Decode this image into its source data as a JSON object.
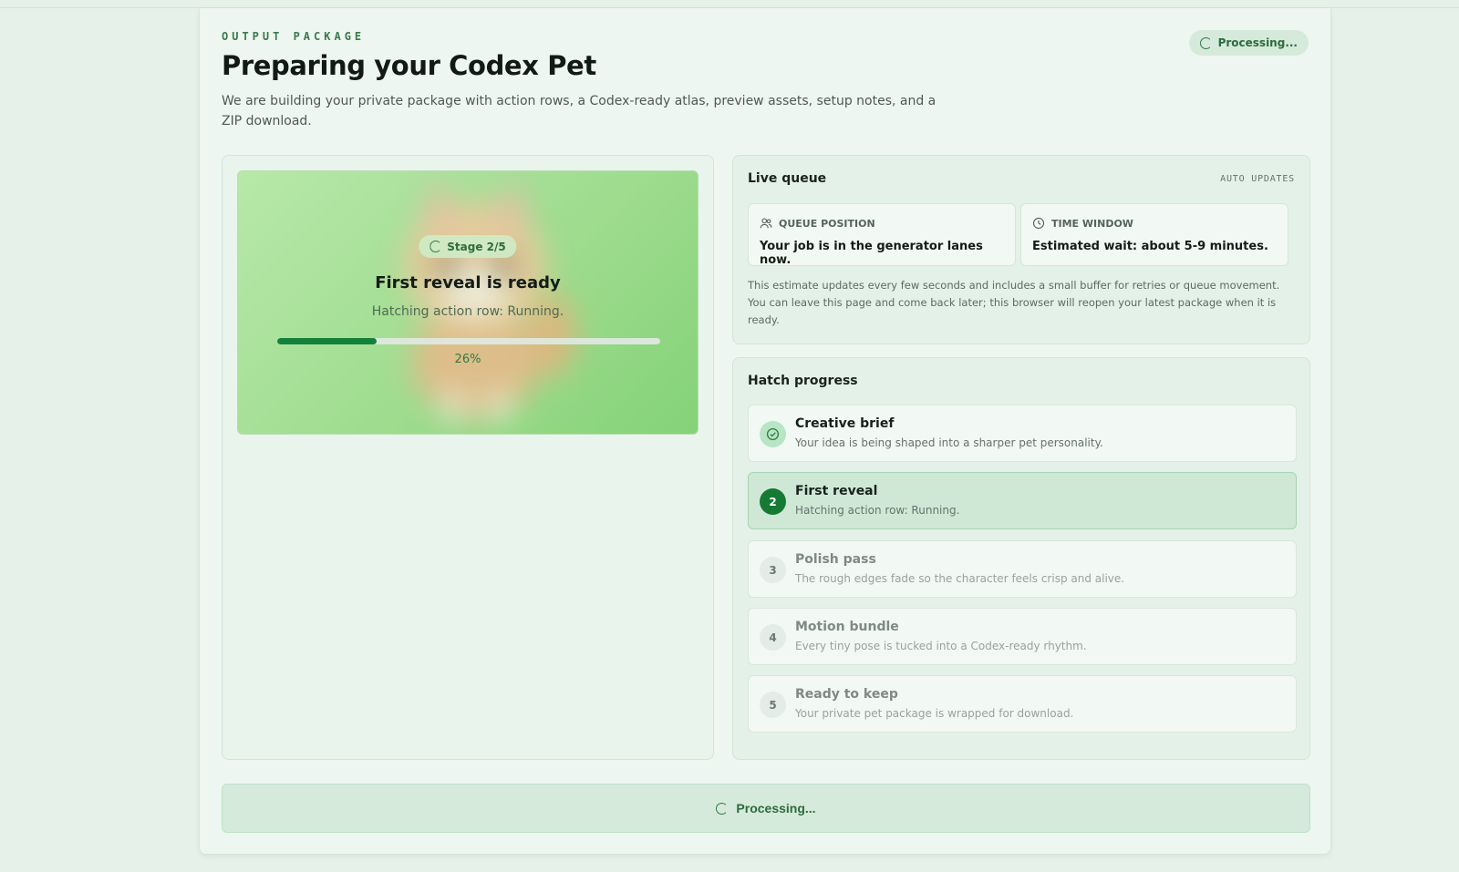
{
  "header": {
    "eyebrow": "OUTPUT PACKAGE",
    "title": "Preparing your Codex Pet",
    "description": "We are building your private package with action rows, a Codex-ready atlas, preview assets, setup notes, and a ZIP download.",
    "status": "Processing..."
  },
  "preview": {
    "stage": "Stage 2/5",
    "title": "First reveal is ready",
    "subtitle": "Hatching action row: Running.",
    "progress": 26,
    "progress_label": "26%"
  },
  "queue": {
    "title": "Live queue",
    "auto_updates": "AUTO UPDATES",
    "position_label": "QUEUE POSITION",
    "position_value": "Your job is in the generator lanes now.",
    "window_label": "TIME WINDOW",
    "window_value": "Estimated wait: about 5-9 minutes.",
    "note": "This estimate updates every few seconds and includes a small buffer for retries or queue movement. You can leave this page and come back later; this browser will reopen your latest package when it is ready."
  },
  "hatch": {
    "title": "Hatch progress",
    "steps": [
      {
        "number": "1",
        "title": "Creative brief",
        "desc": "Your idea is being shaped into a sharper pet personality.",
        "state": "done"
      },
      {
        "number": "2",
        "title": "First reveal",
        "desc": "Hatching action row: Running.",
        "state": "current"
      },
      {
        "number": "3",
        "title": "Polish pass",
        "desc": "The rough edges fade so the character feels crisp and alive.",
        "state": "pending"
      },
      {
        "number": "4",
        "title": "Motion bundle",
        "desc": "Every tiny pose is tucked into a Codex-ready rhythm.",
        "state": "pending"
      },
      {
        "number": "5",
        "title": "Ready to keep",
        "desc": "Your private pet package is wrapped for download.",
        "state": "pending"
      }
    ]
  },
  "footer": {
    "button_label": "Processing..."
  },
  "colors": {
    "accent": "#14813a",
    "background": "#e6f1ea"
  }
}
